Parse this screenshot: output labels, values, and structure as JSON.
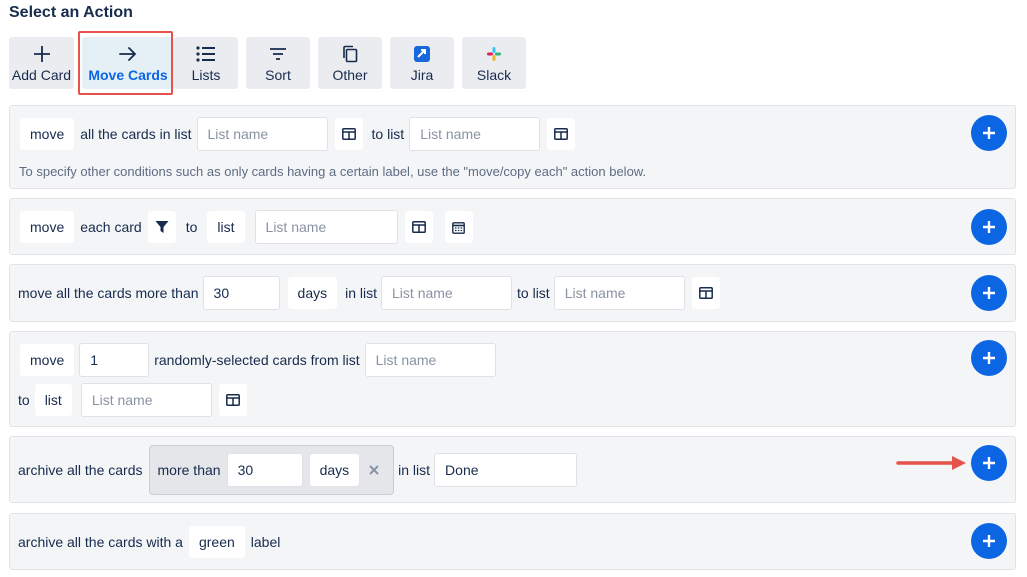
{
  "heading": "Select an Action",
  "tabs": [
    {
      "label": "Add Card",
      "icon": "plus-icon"
    },
    {
      "label": "Move Cards",
      "icon": "arrow-right-icon",
      "active": true
    },
    {
      "label": "Lists",
      "icon": "list-icon"
    },
    {
      "label": "Sort",
      "icon": "sort-icon"
    },
    {
      "label": "Other",
      "icon": "copy-icon"
    },
    {
      "label": "Jira",
      "icon": "jira-icon"
    },
    {
      "label": "Slack",
      "icon": "slack-icon"
    }
  ],
  "colors": {
    "accent": "#0c66e4",
    "highlight": "#e5534b",
    "panel": "#f4f5f7"
  },
  "actions": {
    "move_all": {
      "verb": "move",
      "text1": "all the cards in list",
      "list1_placeholder": "List name",
      "text2": "to list",
      "list2_placeholder": "List name",
      "help": "To specify other conditions such as only cards having a certain label, use the \"move/copy each\" action below."
    },
    "move_each": {
      "verb": "move",
      "text1": "each card",
      "text2": "to",
      "target": "list",
      "list_placeholder": "List name"
    },
    "move_old": {
      "text1": "move all the cards more than",
      "days_value": "30",
      "unit": "days",
      "text2": "in list",
      "list1_placeholder": "List name",
      "text3": "to list",
      "list2_placeholder": "List name"
    },
    "move_random": {
      "verb": "move",
      "count_value": "1",
      "text1": "randomly-selected cards from list",
      "list1_placeholder": "List name",
      "text2": "to",
      "target": "list",
      "list2_placeholder": "List name"
    },
    "archive_old": {
      "text1": "archive all the cards",
      "condition": "more than",
      "days_value": "30",
      "unit": "days",
      "text2": "in list",
      "list_value": "Done"
    },
    "archive_label": {
      "text1": "archive all the cards with a",
      "label_color": "green",
      "text2": "label"
    }
  }
}
